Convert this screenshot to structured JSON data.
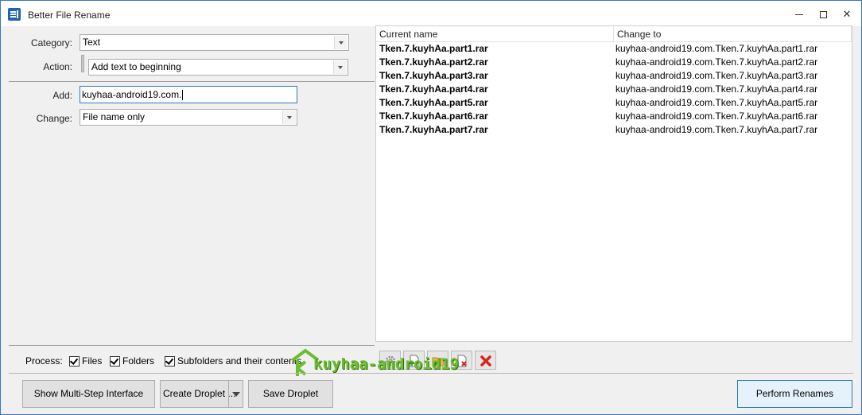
{
  "window": {
    "title": "Better File Rename"
  },
  "form": {
    "category_label": "Category:",
    "category_value": "Text",
    "action_label": "Action:",
    "action_value": "Add text to beginning",
    "add_label": "Add:",
    "add_value": "kuyhaa-android19.com.",
    "change_label": "Change:",
    "change_value": "File name only"
  },
  "file_list": {
    "columns": [
      "Current name",
      "Change to"
    ],
    "rows": [
      {
        "current": "Tken.7.kuyhAa.part1.rar",
        "change_to": "kuyhaa-android19.com.Tken.7.kuyhAa.part1.rar"
      },
      {
        "current": "Tken.7.kuyhAa.part2.rar",
        "change_to": "kuyhaa-android19.com.Tken.7.kuyhAa.part2.rar"
      },
      {
        "current": "Tken.7.kuyhAa.part3.rar",
        "change_to": "kuyhaa-android19.com.Tken.7.kuyhAa.part3.rar"
      },
      {
        "current": "Tken.7.kuyhAa.part4.rar",
        "change_to": "kuyhaa-android19.com.Tken.7.kuyhAa.part4.rar"
      },
      {
        "current": "Tken.7.kuyhAa.part5.rar",
        "change_to": "kuyhaa-android19.com.Tken.7.kuyhAa.part5.rar"
      },
      {
        "current": "Tken.7.kuyhAa.part6.rar",
        "change_to": "kuyhaa-android19.com.Tken.7.kuyhAa.part6.rar"
      },
      {
        "current": "Tken.7.kuyhAa.part7.rar",
        "change_to": "kuyhaa-android19.com.Tken.7.kuyhAa.part7.rar"
      }
    ]
  },
  "toolbar": {
    "icons": [
      "gear-icon",
      "add-file-icon",
      "add-folder-icon",
      "remove-file-icon",
      "delete-icon"
    ]
  },
  "process": {
    "label": "Process:",
    "files_label": "Files",
    "folders_label": "Folders",
    "subfolders_label": "Subfolders and their contents"
  },
  "buttons": {
    "multi_step": "Show Multi-Step Interface",
    "create_droplet": "Create Droplet ...",
    "save_droplet": "Save Droplet",
    "perform_renames": "Perform Renames"
  },
  "watermark": {
    "text": "kuyhaa-android19"
  },
  "colors": {
    "accent": "#2a78c2",
    "delete_red": "#d9241c",
    "watermark_green": "#6bbf2a"
  }
}
